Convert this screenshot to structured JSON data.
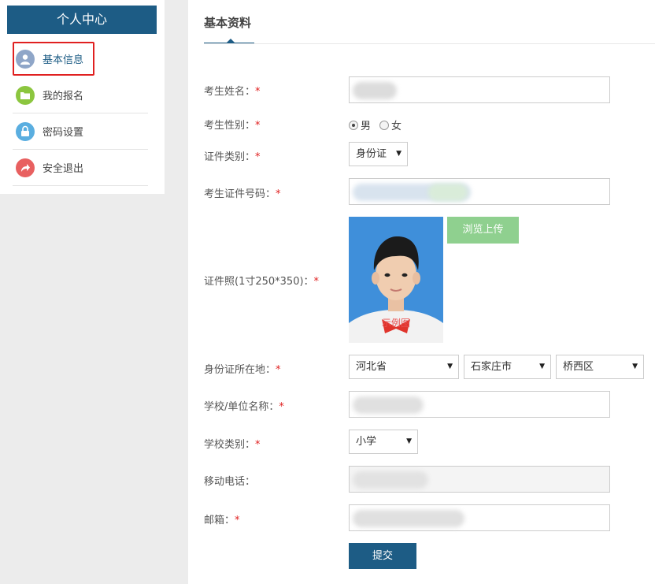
{
  "sidebar": {
    "title": "个人中心",
    "items": [
      {
        "label": "基本信息",
        "icon": "user-icon",
        "color": "#8fa6c8"
      },
      {
        "label": "我的报名",
        "icon": "folder-icon",
        "color": "#8cc63f"
      },
      {
        "label": "密码设置",
        "icon": "lock-icon",
        "color": "#5aaee0"
      },
      {
        "label": "安全退出",
        "icon": "logout-icon",
        "color": "#e86060"
      }
    ]
  },
  "main": {
    "tab_title": "基本资料",
    "form": {
      "name_label": "考生姓名：",
      "gender_label": "考生性别：",
      "gender_male": "男",
      "gender_female": "女",
      "id_type_label": "证件类别：",
      "id_type_value": "身份证",
      "id_number_label": "考生证件号码：",
      "photo_label": "证件照(1寸250*350)：",
      "photo_watermark": "示例图",
      "upload_label": "浏览上传",
      "location_label": "身份证所在地：",
      "province": "河北省",
      "city": "石家庄市",
      "district": "桥西区",
      "school_label": "学校/单位名称：",
      "school_type_label": "学校类别：",
      "school_type_value": "小学",
      "phone_label": "移动电话：",
      "email_label": "邮箱：",
      "required_mark": "*",
      "submit_label": "提交"
    }
  },
  "colors": {
    "primary": "#1d5c85",
    "upload": "#8fd08f",
    "required": "#e02020"
  }
}
